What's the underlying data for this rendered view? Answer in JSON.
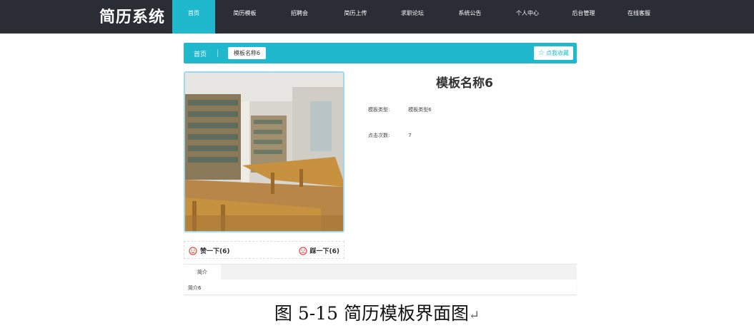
{
  "header": {
    "brand": "简历系统",
    "nav": [
      {
        "label": "首页",
        "active": true,
        "width": 60
      },
      {
        "label": "简历模板",
        "active": false,
        "width": 83
      },
      {
        "label": "招聘会",
        "active": false,
        "width": 70
      },
      {
        "label": "简历上传",
        "active": false,
        "width": 87
      },
      {
        "label": "求职论坛",
        "active": false,
        "width": 72
      },
      {
        "label": "系统公告",
        "active": false,
        "width": 89
      },
      {
        "label": "个人中心",
        "active": false,
        "width": 72
      },
      {
        "label": "后台管理",
        "active": false,
        "width": 85
      },
      {
        "label": "在线客服",
        "active": false,
        "width": 70
      }
    ]
  },
  "breadcrumb": {
    "home": "首页",
    "current": "模板名称6",
    "collect_label": "点我收藏"
  },
  "detail": {
    "title": "模板名称6",
    "type_label": "模板类型:",
    "type_value": "模板类型6",
    "clicks_label": "点击次数:",
    "clicks_value": "7"
  },
  "votes": {
    "like": "赞一下(6)",
    "dislike": "踩一下(6)"
  },
  "tabs": {
    "intro_label": "简介",
    "intro_text": "简介6"
  },
  "caption": {
    "text": "图 5-15 简历模板界面图",
    "mark": "↵"
  },
  "colors": {
    "accent": "#1fb8cc",
    "header_bg": "#2b2d35",
    "vote_icon": "#e0463b"
  }
}
